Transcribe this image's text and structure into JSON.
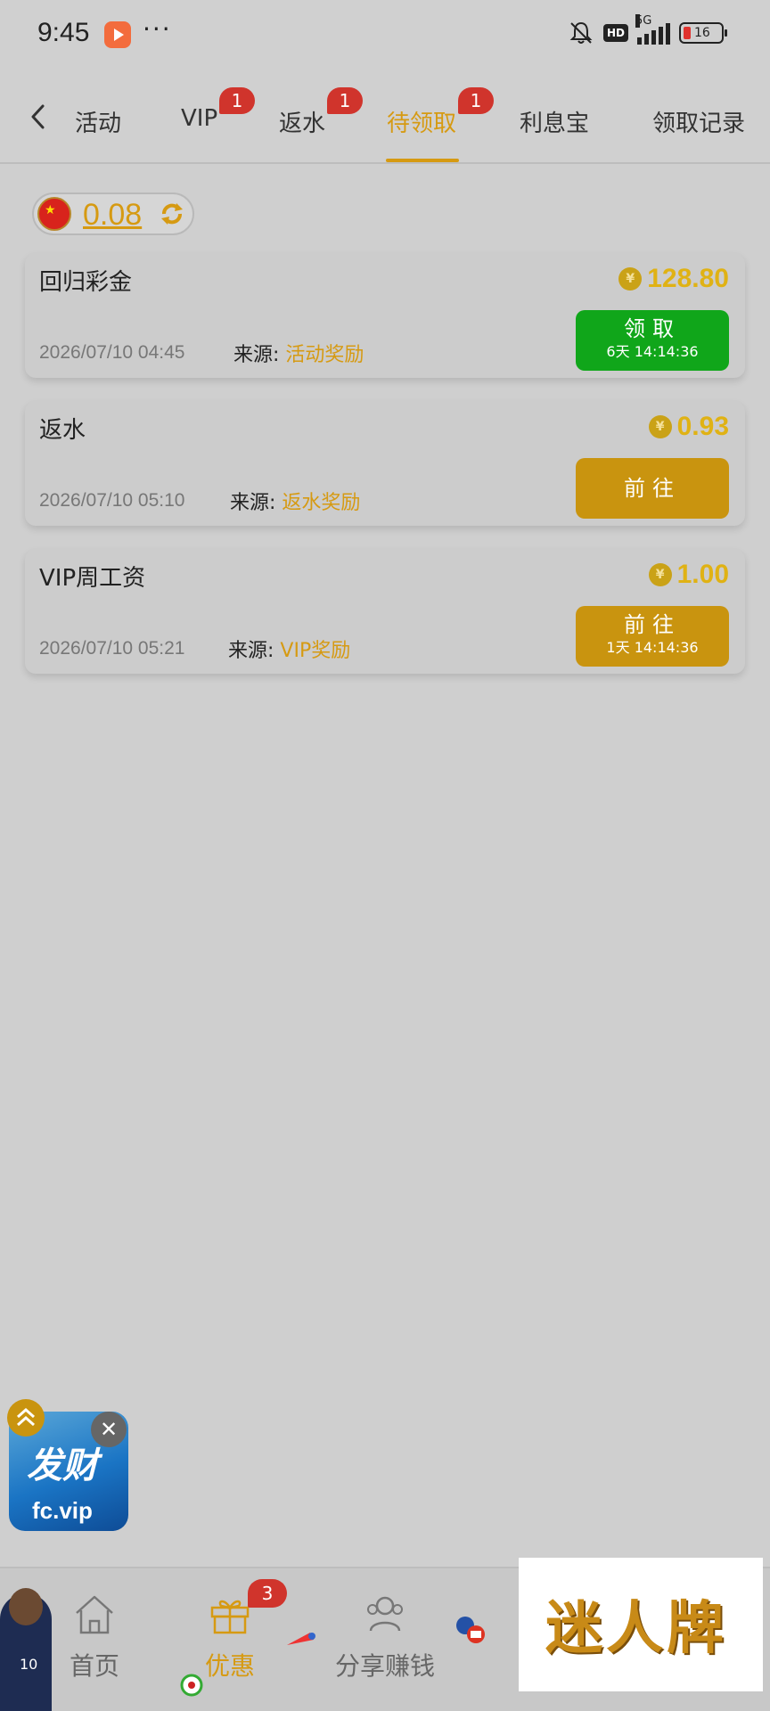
{
  "status_bar": {
    "time": "9:45",
    "dots": "···",
    "hd": "HD",
    "network": "5G",
    "battery": "16"
  },
  "tabs": [
    {
      "label": "活动",
      "badge": null,
      "active": false
    },
    {
      "label": "VIP",
      "badge": "1",
      "active": false
    },
    {
      "label": "返水",
      "badge": "1",
      "active": false
    },
    {
      "label": "待领取",
      "badge": "1",
      "active": true
    },
    {
      "label": "利息宝",
      "badge": null,
      "active": false
    },
    {
      "label": "领取记录",
      "badge": null,
      "active": false
    }
  ],
  "balance": {
    "value": "0.08"
  },
  "source_label": "来源:",
  "rewards": [
    {
      "title": "回归彩金",
      "amount": "128.80",
      "date": "2026/07/10 04:45",
      "source": "活动奖励",
      "button": "领取",
      "timer": "6天 14:14:36",
      "button_style": "green"
    },
    {
      "title": "返水",
      "amount": "0.93",
      "date": "2026/07/10 05:10",
      "source": "返水奖励",
      "button": "前往",
      "timer": "",
      "button_style": "gold"
    },
    {
      "title": "VIP周工资",
      "amount": "1.00",
      "date": "2026/07/10 05:21",
      "source": "VIP奖励",
      "button": "前往",
      "timer": "1天 14:14:36",
      "button_style": "gold"
    }
  ],
  "coin_symbol": "¥",
  "float_ad": {
    "logo": "发财",
    "domain": "fc.vip",
    "close": "✕"
  },
  "bottom_nav": {
    "home": "首页",
    "promo": "优惠",
    "promo_badge": "3",
    "share": "分享赚钱"
  },
  "watermark": "迷人牌",
  "colors": {
    "accent": "#d69a12",
    "claim_green": "#10a61a",
    "goto_gold": "#c9940f",
    "badge_red": "#d0342c"
  }
}
